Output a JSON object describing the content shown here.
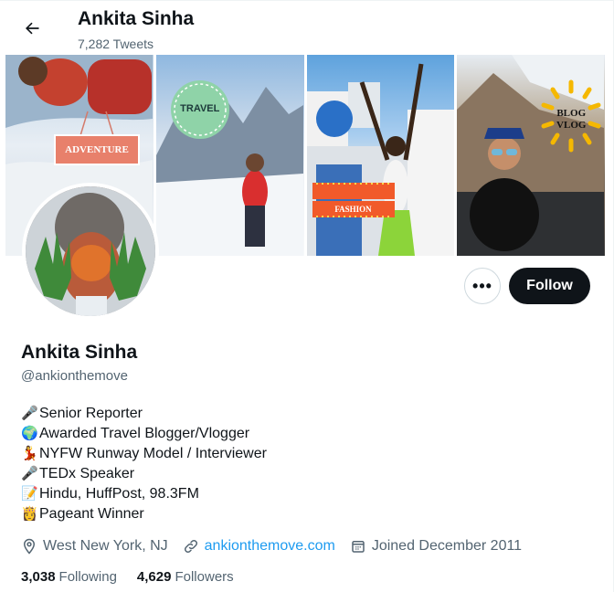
{
  "header": {
    "name": "Ankita Sinha",
    "tweet_count": "7,282 Tweets"
  },
  "banner": {
    "badges": {
      "adventure": "ADVENTURE",
      "travel": "TRAVEL",
      "fashion": "FASHION",
      "blog_vlog": "BLOG VLOG"
    }
  },
  "profile": {
    "name": "Ankita Sinha",
    "handle": "@ankionthemove",
    "more_label": "•••",
    "follow_label": "Follow"
  },
  "bio": [
    {
      "emoji": "🎤",
      "text": "Senior Reporter"
    },
    {
      "emoji": "🌍",
      "text": "Awarded Travel Blogger/Vlogger"
    },
    {
      "emoji": "💃",
      "text": "NYFW Runway Model / Interviewer"
    },
    {
      "emoji": "🎤",
      "text": "TEDx Speaker"
    },
    {
      "emoji": "📝",
      "text": "Hindu, HuffPost, 98.3FM"
    },
    {
      "emoji": "👸",
      "text": "Pageant Winner"
    }
  ],
  "meta": {
    "location": "West New York, NJ",
    "website": "ankionthemove.com",
    "joined": "Joined December 2011"
  },
  "stats": {
    "following_count": "3,038",
    "following_label": "Following",
    "followers_count": "4,629",
    "followers_label": "Followers"
  },
  "colors": {
    "text": "#0f1419",
    "secondary": "#536471",
    "link": "#1d9bf0",
    "button": "#0f1419"
  }
}
